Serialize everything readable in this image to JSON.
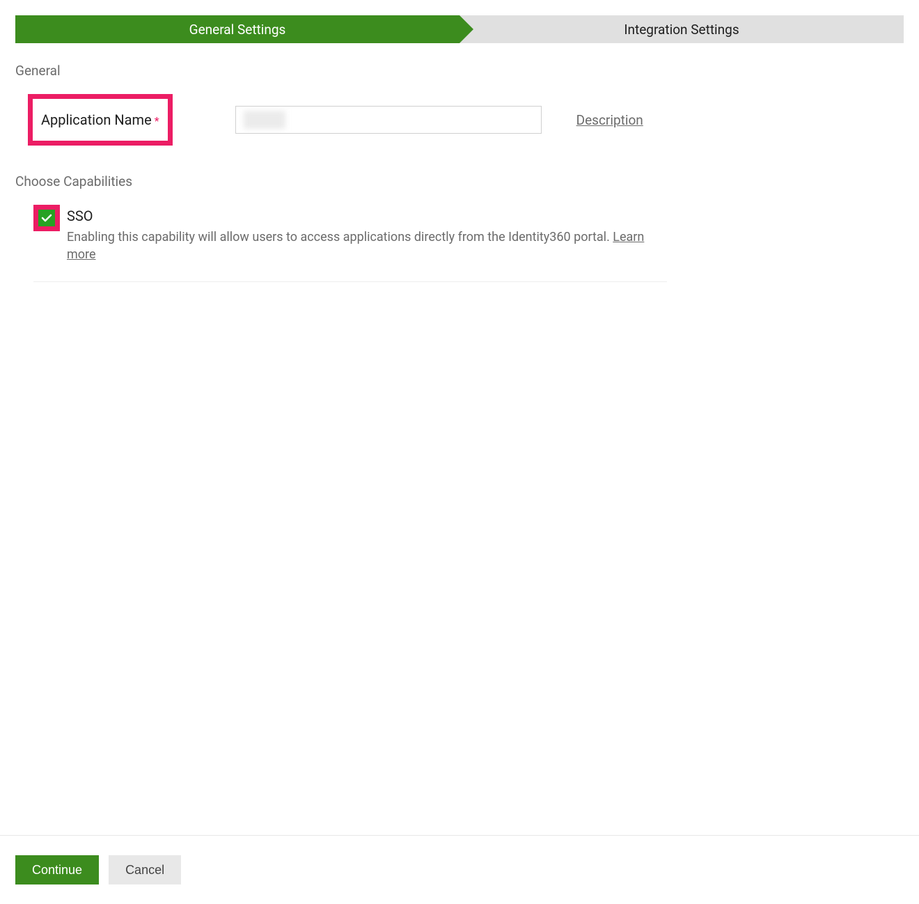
{
  "tabs": {
    "general": "General Settings",
    "integration": "Integration Settings"
  },
  "sections": {
    "general_title": "General",
    "capabilities_title": "Choose Capabilities"
  },
  "form": {
    "app_name_label": "Application Name",
    "required_mark": "*",
    "app_name_value": "",
    "description_link": "Description"
  },
  "capabilities": {
    "sso": {
      "title": "SSO",
      "description_prefix": "Enabling this capability will allow users to access applications directly from the Identity360 portal. ",
      "learn_more": "Learn more"
    }
  },
  "footer": {
    "continue": "Continue",
    "cancel": "Cancel"
  }
}
